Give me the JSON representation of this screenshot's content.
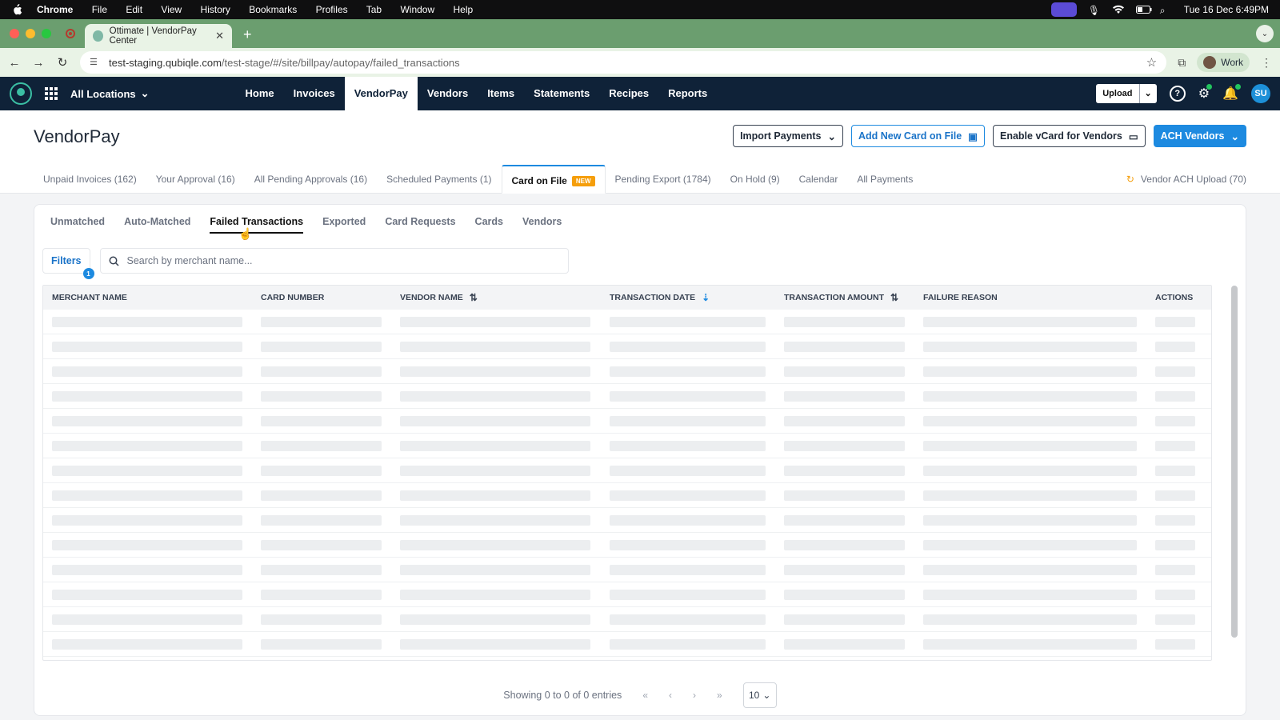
{
  "os_menu": {
    "items": [
      "Chrome",
      "File",
      "Edit",
      "View",
      "History",
      "Bookmarks",
      "Profiles",
      "Tab",
      "Window",
      "Help"
    ],
    "clock": "Tue 16 Dec  6:49PM"
  },
  "browser": {
    "tab_title": "Ottimate | VendorPay Center",
    "url_host": "test-staging.qubiqle.com",
    "url_path": "/test-stage/#/site/billpay/autopay/failed_transactions",
    "profile": "Work"
  },
  "app_header": {
    "location": "All Locations",
    "nav": [
      "Home",
      "Invoices",
      "VendorPay",
      "Vendors",
      "Items",
      "Statements",
      "Recipes",
      "Reports"
    ],
    "active_nav": "VendorPay",
    "upload_label": "Upload",
    "avatar_initials": "SU"
  },
  "page": {
    "title": "VendorPay",
    "actions": {
      "import": "Import Payments",
      "add_card": "Add New Card on File",
      "enable_vcard": "Enable vCard for Vendors",
      "ach": "ACH Vendors"
    },
    "tabs": [
      "Unpaid Invoices (162)",
      "Your Approval (16)",
      "All Pending Approvals (16)",
      "Scheduled Payments (1)",
      "Card on File",
      "Pending Export (1784)",
      "On Hold (9)",
      "Calendar",
      "All Payments"
    ],
    "new_badge": "NEW",
    "ach_upload": "Vendor ACH Upload (70)"
  },
  "card": {
    "tabs": [
      "Unmatched",
      "Auto-Matched",
      "Failed Transactions",
      "Exported",
      "Card Requests",
      "Cards",
      "Vendors"
    ],
    "active_tab": "Failed Transactions",
    "filters_label": "Filters",
    "filters_count": "1",
    "search_placeholder": "Search by merchant name..."
  },
  "table": {
    "columns": [
      "MERCHANT NAME",
      "CARD NUMBER",
      "VENDOR NAME",
      "TRANSACTION DATE",
      "TRANSACTION AMOUNT",
      "FAILURE REASON",
      "ACTIONS"
    ],
    "loading_rows": 14
  },
  "pagination": {
    "summary": "Showing 0 to 0 of 0 entries",
    "page_size": "10"
  },
  "colors": {
    "primary": "#1d8ae0",
    "header_bg": "#0f2238",
    "new_badge": "#f59e0b"
  }
}
